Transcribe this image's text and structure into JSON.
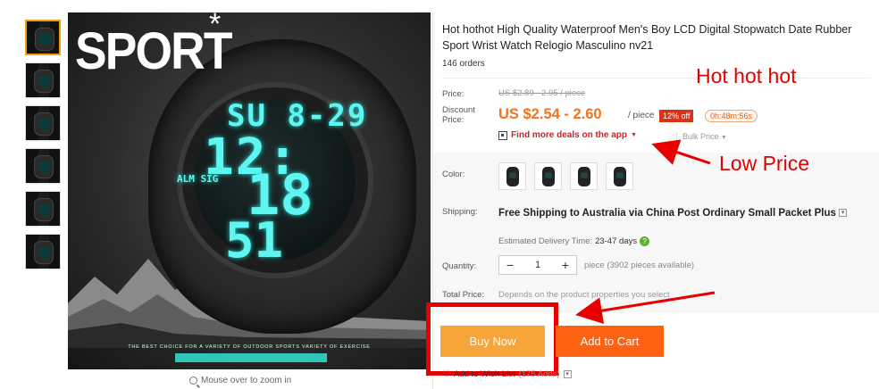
{
  "gallery": {
    "thumbnail_count": 6,
    "brand_text": "SPORT",
    "brand_mark": "*",
    "lcd": {
      "top": "SU 8-29",
      "middle": "12:",
      "big": "18",
      "bottom": "51",
      "labels": "ALM  SIG"
    },
    "tagline": "THE BEST CHOICE FOR A VARIETY OF OUTDOOR SPORTS VARIETY OF EXERCISE",
    "zoom_hint": "Mouse over to zoom in"
  },
  "product": {
    "title": "Hot hothot High Quality Waterproof Men's Boy LCD Digital Stopwatch Date Rubber Sport Wrist Watch Relogio Masculino nv21",
    "orders": "146 orders"
  },
  "pricing": {
    "price_label": "Price:",
    "old_price": "US $2.89 - 2.95 / piece",
    "discount_label_line1": "Discount",
    "discount_label_line2": "Price:",
    "discount_price": "US $2.54 - 2.60",
    "per_unit": "/ piece",
    "off_badge": "12% off",
    "countdown": "0h:48m:56s",
    "deals_link": "Find more deals on the app",
    "bulk_price": "Bulk Price"
  },
  "options": {
    "color_label": "Color:",
    "swatch_count": 4,
    "shipping_label": "Shipping:",
    "shipping_text": "Free Shipping to Australia via China Post Ordinary Small Packet Plus",
    "est_label": "Estimated Delivery Time:",
    "est_days": "23-47 days",
    "quantity_label": "Quantity:",
    "quantity_value": "1",
    "minus": "−",
    "plus": "+",
    "quantity_note": "piece (3902 pieces available)",
    "total_label": "Total Price:",
    "total_note": "Depends on the product properties you select"
  },
  "actions": {
    "buy_now": "Buy Now",
    "add_to_cart": "Add to Cart",
    "wishlist": "Add to Wish List",
    "wishlist_count": "(175 Adds)"
  },
  "annotations": {
    "hot": "Hot hot hot",
    "low": "Low Price"
  },
  "colors": {
    "accent_orange": "#f4721c",
    "buy_now": "#f7a538",
    "add_to_cart": "#fd6213",
    "annotation_red": "#e60000",
    "lcd_cyan": "#5ff5f0"
  }
}
